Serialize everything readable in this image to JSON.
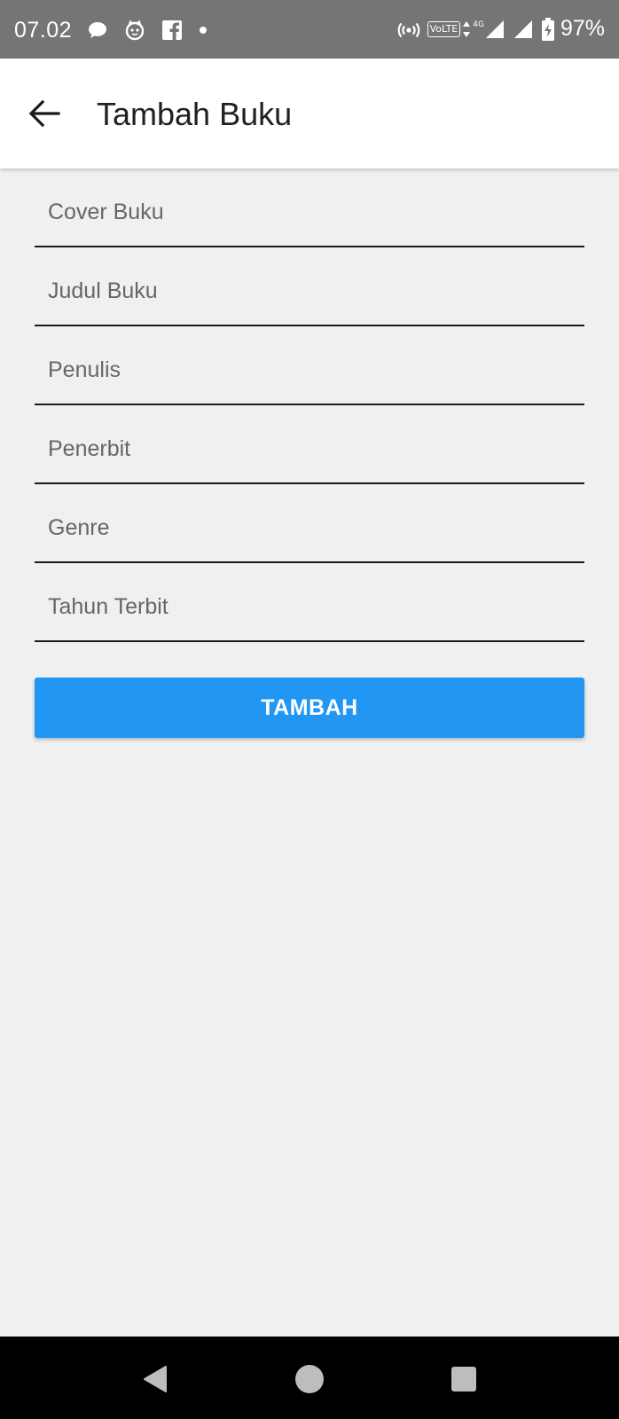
{
  "status_bar": {
    "time": "07.02",
    "left_icons": [
      "chat-bubble-icon",
      "cat-face-icon",
      "facebook-icon",
      "dot-icon"
    ],
    "right_icons": [
      "hotspot-icon",
      "volte-icon",
      "signal-icon",
      "signal-icon",
      "battery-charging-icon"
    ],
    "volte_label": "VoLTE",
    "network_type": "4G",
    "battery_percent": "97%"
  },
  "app_bar": {
    "back_icon": "arrow-left-icon",
    "title": "Tambah Buku"
  },
  "form": {
    "fields": [
      {
        "placeholder": "Cover Buku",
        "value": ""
      },
      {
        "placeholder": "Judul Buku",
        "value": ""
      },
      {
        "placeholder": "Penulis",
        "value": ""
      },
      {
        "placeholder": "Penerbit",
        "value": ""
      },
      {
        "placeholder": "Genre",
        "value": ""
      },
      {
        "placeholder": "Tahun Terbit",
        "value": ""
      }
    ],
    "submit_label": "TAMBAH"
  },
  "nav_bar": {
    "icons": [
      "back-triangle-icon",
      "home-circle-icon",
      "recents-square-icon"
    ]
  },
  "colors": {
    "status_bar": "#757575",
    "app_bar": "#ffffff",
    "background": "#f0f0f0",
    "accent": "#2196f3",
    "nav_bar": "#000000"
  }
}
